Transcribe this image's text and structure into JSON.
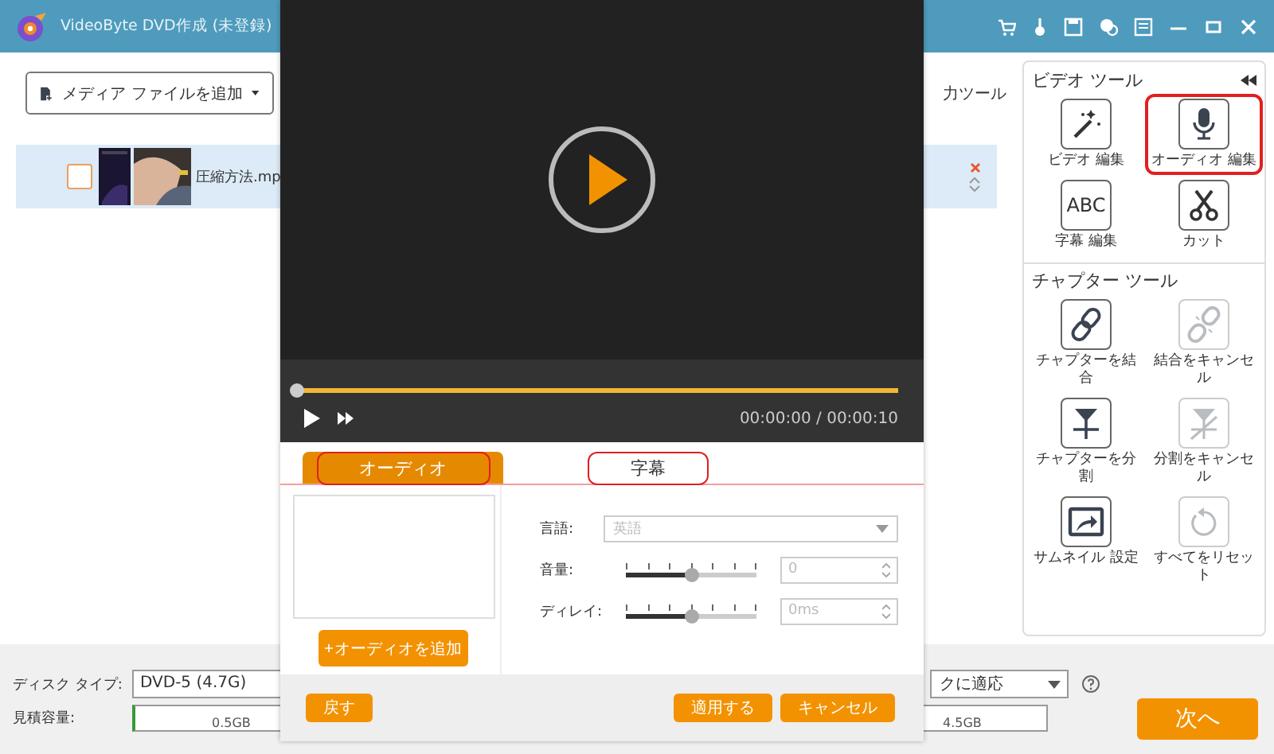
{
  "window": {
    "title": "VideoByte DVD作成 (未登録)"
  },
  "toolbar": {
    "add_media": "メディア ファイルを追加",
    "tools_link": "力ツール"
  },
  "files": [
    {
      "name": "圧縮方法.mp",
      "checked": false
    }
  ],
  "tool_panel": {
    "video_tools_title": "ビデオ ツール",
    "video_tools": [
      {
        "label": "ビデオ 編集",
        "disabled": false,
        "highlighted": false
      },
      {
        "label": "オーディオ 編集",
        "disabled": false,
        "highlighted": true
      },
      {
        "icon_text": "ABC",
        "label": "字幕 編集",
        "disabled": false,
        "highlighted": false
      },
      {
        "label": "カット",
        "disabled": false,
        "highlighted": false
      }
    ],
    "chapter_tools_title": "チャプター ツール",
    "chapter_tools": [
      {
        "label": "チャプターを結合",
        "disabled": false,
        "highlighted": false
      },
      {
        "label": "結合をキャンセル",
        "disabled": true,
        "highlighted": false
      },
      {
        "label": "チャプターを分割",
        "disabled": false,
        "highlighted": false
      },
      {
        "label": "分割をキャンセル",
        "disabled": true,
        "highlighted": false
      },
      {
        "label": "サムネイル 設定",
        "disabled": false,
        "highlighted": false
      },
      {
        "label": "すべてをリセット",
        "disabled": true,
        "highlighted": false
      }
    ]
  },
  "bottom": {
    "disc_type_label": "ディスク タイプ:",
    "disc_type": "DVD-5 (4.7G)",
    "fit_select": "クに適応",
    "capacity_label": "見積容量:",
    "capacity_ticks": [
      "0.5GB",
      "4.5GB"
    ],
    "next": "次へ"
  },
  "dialog": {
    "player": {
      "level": 0,
      "time": "00:00:00 / 00:00:10"
    },
    "tabs": [
      {
        "label": "オーディオ",
        "selected": true,
        "highlighted": true
      },
      {
        "label": "字幕",
        "selected": false,
        "highlighted": true
      }
    ],
    "add_audio": "オーディオを追加",
    "settings": [
      {
        "kind": "select",
        "label": "言語:",
        "value": "英語"
      },
      {
        "kind": "slider",
        "label": "音量:",
        "level": 0.5,
        "value": "0"
      },
      {
        "kind": "slider",
        "label": "ディレイ:",
        "level": 0.5,
        "value": "0ms"
      }
    ],
    "buttons": {
      "back": "戻す",
      "apply": "適用する",
      "cancel": "キャンセル"
    }
  }
}
